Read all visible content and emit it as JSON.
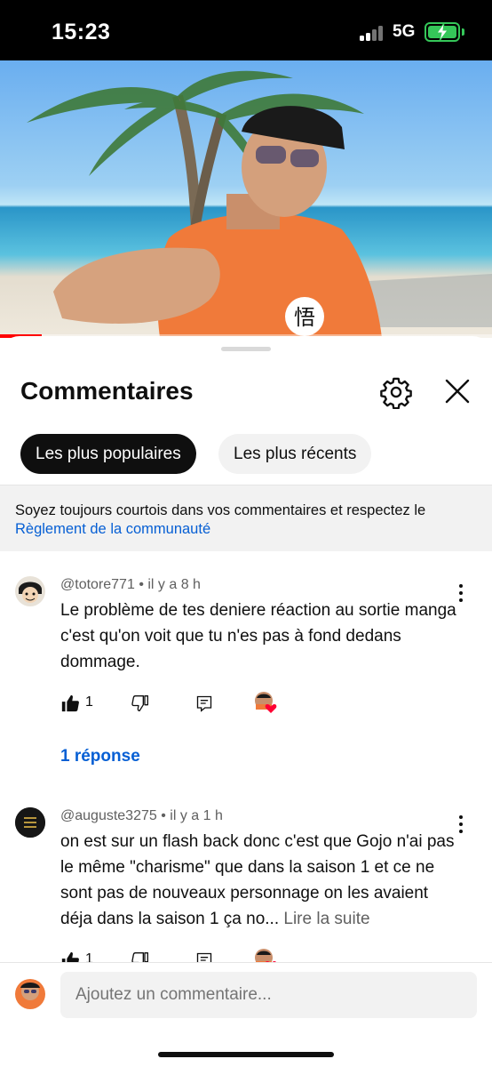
{
  "status_bar": {
    "time": "15:23",
    "network": "5G"
  },
  "video": {
    "progress_fraction": 0.085
  },
  "panel": {
    "title": "Commentaires"
  },
  "sort": {
    "options": [
      "Les plus populaires",
      "Les plus récents"
    ],
    "selected": "Les plus populaires"
  },
  "notice": {
    "text": "Soyez toujours courtois dans vos commentaires et respectez le",
    "link": "Règlement de la communauté"
  },
  "comments": [
    {
      "author": "@totore771",
      "age": "il y a 8 h",
      "text": "Le problème de tes deniere réaction au sortie manga c'est qu'on voit que tu n'es pas à fond dedans dommage.",
      "likes": "1",
      "replies": "1 réponse"
    },
    {
      "author": "@auguste3275",
      "age": "il y a 1 h",
      "text": "on est sur un flash back donc c'est que Gojo n'ai pas le même \"charisme\" que dans la saison 1 et ce ne sont pas de nouveaux personnage on les avaient déja dans la saison 1 ça no...",
      "read_more": "Lire la suite",
      "likes": "1"
    }
  ],
  "composer": {
    "placeholder": "Ajoutez un commentaire..."
  },
  "colors": {
    "accent_link": "#065fd4",
    "progress": "#ff0000",
    "battery": "#35c759"
  }
}
